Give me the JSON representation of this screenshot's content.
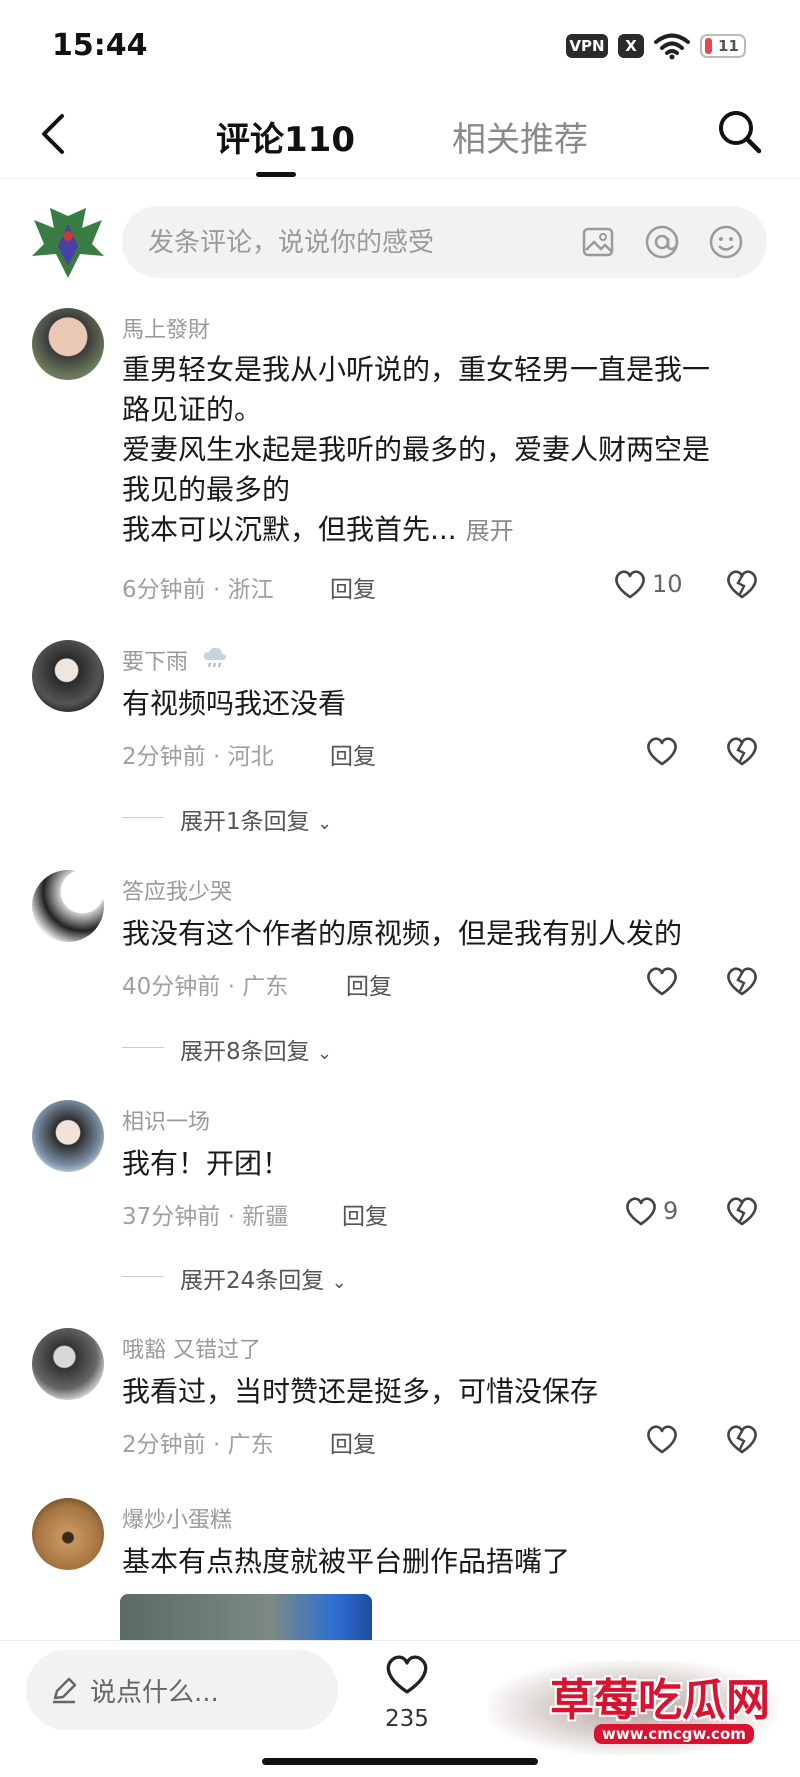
{
  "status_bar": {
    "time": "15:44",
    "vpn": "VPN",
    "x_badge": "X",
    "battery": "11"
  },
  "header": {
    "tab_comments": "评论110",
    "tab_related": "相关推荐"
  },
  "composer": {
    "placeholder": "发条评论，说说你的感受"
  },
  "comments": [
    {
      "user": "馬上發財",
      "lines": [
        "重男轻女是我从小听说的，重女轻男一直是我一",
        "路见证的。",
        "爱妻风生水起是我听的最多的，爱妻人财两空是",
        "我见的最多的",
        "我本可以沉默，但我首先..."
      ],
      "more": "展开",
      "time": "6分钟前 · 浙江",
      "reply": "回复",
      "likes": "10"
    },
    {
      "user": "要下雨",
      "lines": [
        "有视频吗我还没看"
      ],
      "time": "2分钟前 · 河北",
      "reply": "回复",
      "expand": "展开1条回复"
    },
    {
      "user": "答应我少哭",
      "lines": [
        "我没有这个作者的原视频，但是我有别人发的"
      ],
      "time": "40分钟前 · 广东",
      "reply": "回复",
      "expand": "展开8条回复"
    },
    {
      "user": "相识一场",
      "lines": [
        "我有！开团！"
      ],
      "time": "37分钟前 · 新疆",
      "reply": "回复",
      "likes": "9",
      "expand": "展开24条回复"
    },
    {
      "user": "哦豁 又错过了",
      "lines": [
        "我看过，当时赞还是挺多，可惜没保存"
      ],
      "time": "2分钟前 · 广东",
      "reply": "回复"
    },
    {
      "user": "爆炒小蛋糕",
      "lines": [
        "基本有点热度就被平台删作品捂嘴了"
      ]
    }
  ],
  "bottom_bar": {
    "input_placeholder": "说点什么...",
    "like_count": "235"
  },
  "watermark": {
    "text": "草莓吃瓜网",
    "url": "www.cmcgw.com"
  },
  "colors": {
    "accent_red": "#e5484d",
    "watermark_red": "#d9122f",
    "text": "#1a1a1a",
    "muted": "#9a9a9a"
  }
}
